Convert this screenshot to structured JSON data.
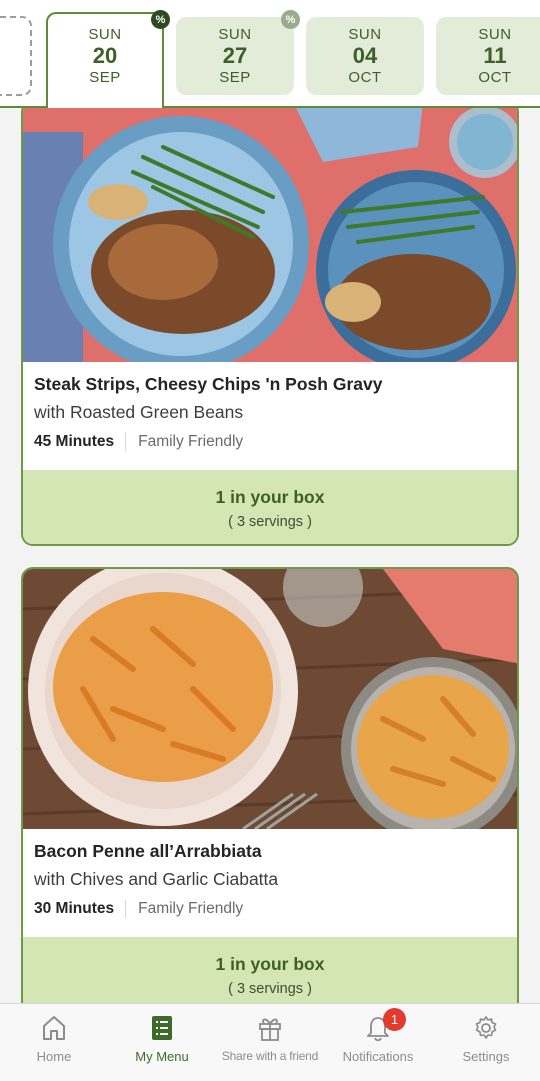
{
  "datebar": {
    "tabs": [
      {
        "dow": "SUN",
        "day": "20",
        "month": "SEP",
        "active": true,
        "promo": true
      },
      {
        "dow": "SUN",
        "day": "27",
        "month": "SEP",
        "active": false,
        "promo": true
      },
      {
        "dow": "SUN",
        "day": "04",
        "month": "OCT",
        "active": false,
        "promo": false
      },
      {
        "dow": "SUN",
        "day": "11",
        "month": "OCT",
        "active": false,
        "promo": false
      }
    ],
    "promo_symbol": "%"
  },
  "recipes": [
    {
      "title": "Steak Strips, Cheesy Chips 'n Posh Gravy",
      "subtitle": "with Roasted Green Beans",
      "time": "45 Minutes",
      "tag": "Family Friendly",
      "box_status": "1 in your box",
      "servings": "( 3 servings )"
    },
    {
      "title": "Bacon Penne all’Arrabbiata",
      "subtitle": "with Chives and Garlic Ciabatta",
      "time": "30 Minutes",
      "tag": "Family Friendly",
      "box_status": "1 in your box",
      "servings": "( 3 servings )"
    }
  ],
  "bottom_nav": {
    "items": [
      {
        "label": "Home",
        "icon": "home-icon",
        "active": false
      },
      {
        "label": "My Menu",
        "icon": "menu-icon",
        "active": true
      },
      {
        "label": "Share with a friend",
        "icon": "gift-icon",
        "active": false
      },
      {
        "label": "Notifications",
        "icon": "bell-icon",
        "active": false,
        "badge": "1"
      },
      {
        "label": "Settings",
        "icon": "gear-icon",
        "active": false
      }
    ]
  },
  "colors": {
    "accent": "#5f8a3a",
    "tab_bg": "#e3ecd8",
    "card_footer": "#d4e6b3",
    "promo_badge_active": "#2f4a22",
    "promo_badge_inactive": "#9aaa8c",
    "notification_badge": "#e23b2e"
  }
}
